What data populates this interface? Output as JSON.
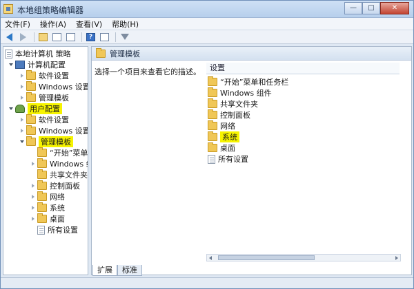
{
  "window": {
    "title": "本地组策略编辑器",
    "minimize_glyph": "—",
    "maximize_glyph": "□",
    "close_glyph": "✕"
  },
  "menu": [
    "文件(F)",
    "操作(A)",
    "查看(V)",
    "帮助(H)"
  ],
  "toolbar": {
    "icons": [
      "back-icon",
      "forward-icon",
      "up-folder-icon",
      "show-hide-tree-icon",
      "export-list-icon",
      "help-icon",
      "properties-icon",
      "filter-icon"
    ],
    "help_glyph": "?"
  },
  "tree": {
    "root": "本地计算机 策略",
    "computer_config": "计算机配置",
    "computer_children": [
      "软件设置",
      "Windows 设置",
      "管理模板"
    ],
    "user_config": "用户配置",
    "user_children": [
      "软件设置",
      "Windows 设置"
    ],
    "admin_templates": "管理模板",
    "admin_children": [
      "“开始”菜单",
      "Windows 组件",
      "共享文件夹",
      "控制面板",
      "网络",
      "系统",
      "桌面",
      "所有设置"
    ]
  },
  "highlight_color": "#f6f300",
  "right_pane": {
    "header_title": "管理模板",
    "description": "选择一个项目来查看它的描述。",
    "column_header": "设置",
    "items": [
      "“开始”菜单和任务栏",
      "Windows 组件",
      "共享文件夹",
      "控制面板",
      "网络",
      "系统",
      "桌面",
      "所有设置"
    ]
  },
  "tabs": [
    "扩展",
    "标准"
  ]
}
